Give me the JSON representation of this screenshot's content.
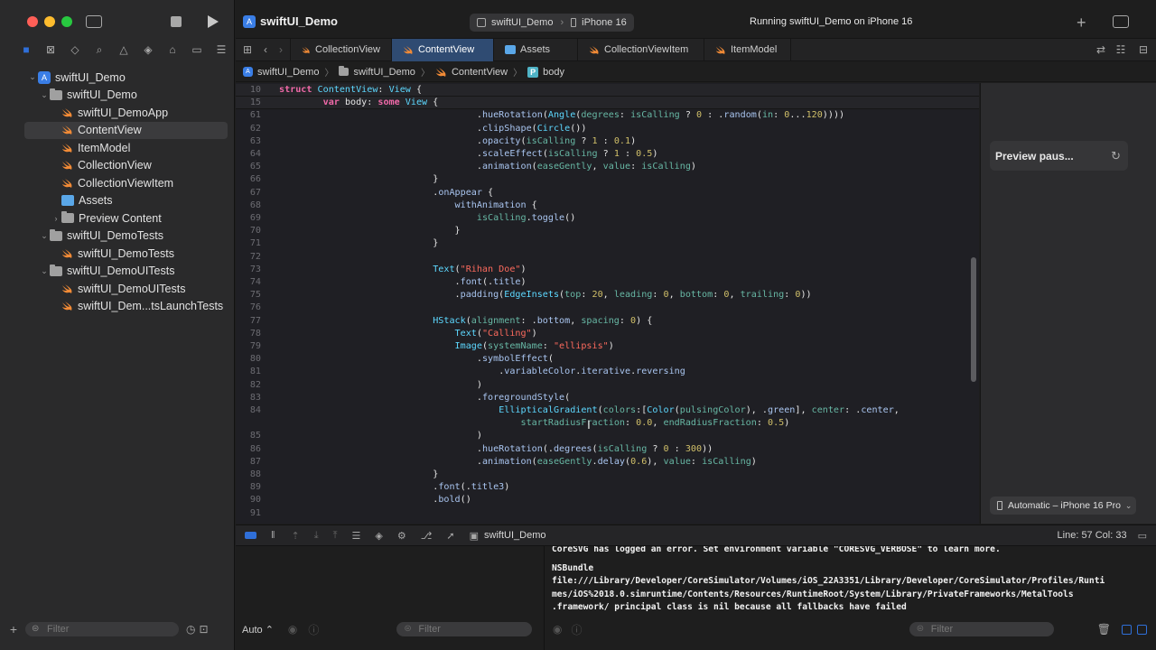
{
  "window": {
    "project_title": "swiftUI_Demo",
    "scheme": "swiftUI_Demo",
    "destination": "iPhone 16",
    "status": "Running swiftUI_Demo on iPhone 16"
  },
  "tabs": [
    {
      "label": "CollectionView",
      "icon": "swift-file-icon"
    },
    {
      "label": "ContentView",
      "icon": "swift-file-icon",
      "active": true
    },
    {
      "label": "Assets",
      "icon": "assets-icon"
    },
    {
      "label": "CollectionViewItem",
      "icon": "swift-file-icon"
    },
    {
      "label": "ItemModel",
      "icon": "swift-file-icon"
    }
  ],
  "breadcrumb": [
    "swiftUI_Demo",
    "swiftUI_Demo",
    "ContentView",
    "body"
  ],
  "navigator": {
    "items": [
      {
        "label": "swiftUI_Demo",
        "kind": "project",
        "depth": 0,
        "expanded": true
      },
      {
        "label": "swiftUI_Demo",
        "kind": "folder",
        "depth": 1,
        "expanded": true
      },
      {
        "label": "swiftUI_DemoApp",
        "kind": "swift",
        "depth": 2
      },
      {
        "label": "ContentView",
        "kind": "swift",
        "depth": 2,
        "selected": true
      },
      {
        "label": "ItemModel",
        "kind": "swift",
        "depth": 2
      },
      {
        "label": "CollectionView",
        "kind": "swift",
        "depth": 2
      },
      {
        "label": "CollectionViewItem",
        "kind": "swift",
        "depth": 2
      },
      {
        "label": "Assets",
        "kind": "assets",
        "depth": 2
      },
      {
        "label": "Preview Content",
        "kind": "folder",
        "depth": 2,
        "expanded": false
      },
      {
        "label": "swiftUI_DemoTests",
        "kind": "folder",
        "depth": 1,
        "expanded": true
      },
      {
        "label": "swiftUI_DemoTests",
        "kind": "swift",
        "depth": 2
      },
      {
        "label": "swiftUI_DemoUITests",
        "kind": "folder",
        "depth": 1,
        "expanded": true
      },
      {
        "label": "swiftUI_DemoUITests",
        "kind": "swift",
        "depth": 2
      },
      {
        "label": "swiftUI_Dem...tsLaunchTests",
        "kind": "swift",
        "depth": 2
      }
    ],
    "filter_placeholder": "Filter"
  },
  "code": [
    {
      "n": "10",
      "sticky": true,
      "ind": 0,
      "tok": [
        [
          "k",
          "struct "
        ],
        [
          "t",
          "ContentView"
        ],
        [
          "d",
          ": "
        ],
        [
          "t",
          "View"
        ],
        [
          "d",
          " {"
        ]
      ]
    },
    {
      "n": "15",
      "sticky": true,
      "ind": 8,
      "tok": [
        [
          "k",
          "var "
        ],
        [
          "d",
          "body"
        ],
        [
          "d",
          ": "
        ],
        [
          "k",
          "some "
        ],
        [
          "t",
          "View"
        ],
        [
          "d",
          " {"
        ]
      ]
    },
    {
      "n": "61",
      "ind": 36,
      "tok": [
        [
          "d",
          "."
        ],
        [
          "f",
          "hueRotation"
        ],
        [
          "d",
          "("
        ],
        [
          "t",
          "Angle"
        ],
        [
          "d",
          "("
        ],
        [
          "p",
          "degrees"
        ],
        [
          "d",
          ": "
        ],
        [
          "p",
          "isCalling"
        ],
        [
          "d",
          " ? "
        ],
        [
          "n",
          "0"
        ],
        [
          "d",
          " : ."
        ],
        [
          "f",
          "random"
        ],
        [
          "d",
          "("
        ],
        [
          "p",
          "in"
        ],
        [
          "d",
          ": "
        ],
        [
          "n",
          "0"
        ],
        [
          "d",
          "..."
        ],
        [
          "n",
          "120"
        ],
        [
          "d",
          "))))"
        ]
      ]
    },
    {
      "n": "62",
      "ind": 36,
      "tok": [
        [
          "d",
          "."
        ],
        [
          "f",
          "clipShape"
        ],
        [
          "d",
          "("
        ],
        [
          "t",
          "Circle"
        ],
        [
          "d",
          "())"
        ]
      ]
    },
    {
      "n": "63",
      "ind": 36,
      "tok": [
        [
          "d",
          "."
        ],
        [
          "f",
          "opacity"
        ],
        [
          "d",
          "("
        ],
        [
          "p",
          "isCalling"
        ],
        [
          "d",
          " ? "
        ],
        [
          "n",
          "1"
        ],
        [
          "d",
          " : "
        ],
        [
          "n",
          "0.1"
        ],
        [
          "d",
          ")"
        ]
      ]
    },
    {
      "n": "64",
      "ind": 36,
      "tok": [
        [
          "d",
          "."
        ],
        [
          "f",
          "scaleEffect"
        ],
        [
          "d",
          "("
        ],
        [
          "p",
          "isCalling"
        ],
        [
          "d",
          " ? "
        ],
        [
          "n",
          "1"
        ],
        [
          "d",
          " : "
        ],
        [
          "n",
          "0.5"
        ],
        [
          "d",
          ")"
        ]
      ]
    },
    {
      "n": "65",
      "ind": 36,
      "tok": [
        [
          "d",
          "."
        ],
        [
          "f",
          "animation"
        ],
        [
          "d",
          "("
        ],
        [
          "p",
          "easeGently"
        ],
        [
          "d",
          ", "
        ],
        [
          "p",
          "value"
        ],
        [
          "d",
          ": "
        ],
        [
          "p",
          "isCalling"
        ],
        [
          "d",
          ")"
        ]
      ]
    },
    {
      "n": "66",
      "ind": 28,
      "tok": [
        [
          "d",
          "}"
        ]
      ]
    },
    {
      "n": "67",
      "ind": 28,
      "tok": [
        [
          "d",
          "."
        ],
        [
          "f",
          "onAppear"
        ],
        [
          "d",
          " {"
        ]
      ]
    },
    {
      "n": "68",
      "ind": 32,
      "tok": [
        [
          "f",
          "withAnimation"
        ],
        [
          "d",
          " {"
        ]
      ]
    },
    {
      "n": "69",
      "ind": 36,
      "tok": [
        [
          "p",
          "isCalling"
        ],
        [
          "d",
          "."
        ],
        [
          "f",
          "toggle"
        ],
        [
          "d",
          "()"
        ]
      ]
    },
    {
      "n": "70",
      "ind": 32,
      "tok": [
        [
          "d",
          "}"
        ]
      ]
    },
    {
      "n": "71",
      "ind": 28,
      "tok": [
        [
          "d",
          "}"
        ]
      ]
    },
    {
      "n": "72",
      "ind": 0,
      "tok": []
    },
    {
      "n": "73",
      "ind": 28,
      "tok": [
        [
          "t",
          "Text"
        ],
        [
          "d",
          "("
        ],
        [
          "s",
          "\"Rihan Doe\""
        ],
        [
          "d",
          ")"
        ]
      ]
    },
    {
      "n": "74",
      "ind": 32,
      "tok": [
        [
          "d",
          "."
        ],
        [
          "f",
          "font"
        ],
        [
          "d",
          "(."
        ],
        [
          "f",
          "title"
        ],
        [
          "d",
          ")"
        ]
      ]
    },
    {
      "n": "75",
      "ind": 32,
      "tok": [
        [
          "d",
          "."
        ],
        [
          "f",
          "padding"
        ],
        [
          "d",
          "("
        ],
        [
          "t",
          "EdgeInsets"
        ],
        [
          "d",
          "("
        ],
        [
          "p",
          "top"
        ],
        [
          "d",
          ": "
        ],
        [
          "n",
          "20"
        ],
        [
          "d",
          ", "
        ],
        [
          "p",
          "leading"
        ],
        [
          "d",
          ": "
        ],
        [
          "n",
          "0"
        ],
        [
          "d",
          ", "
        ],
        [
          "p",
          "bottom"
        ],
        [
          "d",
          ": "
        ],
        [
          "n",
          "0"
        ],
        [
          "d",
          ", "
        ],
        [
          "p",
          "trailing"
        ],
        [
          "d",
          ": "
        ],
        [
          "n",
          "0"
        ],
        [
          "d",
          "))"
        ]
      ]
    },
    {
      "n": "76",
      "ind": 0,
      "tok": []
    },
    {
      "n": "77",
      "ind": 28,
      "tok": [
        [
          "t",
          "HStack"
        ],
        [
          "d",
          "("
        ],
        [
          "p",
          "alignment"
        ],
        [
          "d",
          ": ."
        ],
        [
          "f",
          "bottom"
        ],
        [
          "d",
          ", "
        ],
        [
          "p",
          "spacing"
        ],
        [
          "d",
          ": "
        ],
        [
          "n",
          "0"
        ],
        [
          "d",
          ") {"
        ]
      ]
    },
    {
      "n": "78",
      "ind": 32,
      "tok": [
        [
          "t",
          "Text"
        ],
        [
          "d",
          "("
        ],
        [
          "s",
          "\"Calling\""
        ],
        [
          "d",
          ")"
        ]
      ]
    },
    {
      "n": "79",
      "ind": 32,
      "tok": [
        [
          "t",
          "Image"
        ],
        [
          "d",
          "("
        ],
        [
          "p",
          "systemName"
        ],
        [
          "d",
          ": "
        ],
        [
          "s",
          "\"ellipsis\""
        ],
        [
          "d",
          ")"
        ]
      ]
    },
    {
      "n": "80",
      "ind": 36,
      "tok": [
        [
          "d",
          "."
        ],
        [
          "f",
          "symbolEffect"
        ],
        [
          "d",
          "("
        ]
      ]
    },
    {
      "n": "81",
      "ind": 40,
      "tok": [
        [
          "d",
          "."
        ],
        [
          "f",
          "variableColor"
        ],
        [
          "d",
          "."
        ],
        [
          "f",
          "iterative"
        ],
        [
          "d",
          "."
        ],
        [
          "f",
          "reversing"
        ]
      ]
    },
    {
      "n": "82",
      "ind": 36,
      "tok": [
        [
          "d",
          ")"
        ]
      ]
    },
    {
      "n": "83",
      "ind": 36,
      "tok": [
        [
          "d",
          "."
        ],
        [
          "f",
          "foregroundStyle"
        ],
        [
          "d",
          "("
        ]
      ]
    },
    {
      "n": "84",
      "ind": 40,
      "tok": [
        [
          "t",
          "EllipticalGradient"
        ],
        [
          "d",
          "("
        ],
        [
          "p",
          "colors"
        ],
        [
          "d",
          ":["
        ],
        [
          "t",
          "Color"
        ],
        [
          "d",
          "("
        ],
        [
          "p",
          "pulsingColor"
        ],
        [
          "d",
          "), ."
        ],
        [
          "f",
          "green"
        ],
        [
          "d",
          "], "
        ],
        [
          "p",
          "center"
        ],
        [
          "d",
          ": ."
        ],
        [
          "f",
          "center"
        ],
        [
          "d",
          ","
        ]
      ]
    },
    {
      "n": "",
      "ind": 44,
      "tok": [
        [
          "p",
          "startRadiusFraction"
        ],
        [
          "d",
          ": "
        ],
        [
          "n",
          "0.0"
        ],
        [
          "d",
          ", "
        ],
        [
          "p",
          "endRadiusFraction"
        ],
        [
          "d",
          ": "
        ],
        [
          "n",
          "0.5"
        ],
        [
          "d",
          ")"
        ]
      ]
    },
    {
      "n": "85",
      "ind": 36,
      "tok": [
        [
          "d",
          ")"
        ]
      ]
    },
    {
      "n": "86",
      "ind": 36,
      "tok": [
        [
          "d",
          "."
        ],
        [
          "f",
          "hueRotation"
        ],
        [
          "d",
          "(."
        ],
        [
          "f",
          "degrees"
        ],
        [
          "d",
          "("
        ],
        [
          "p",
          "isCalling"
        ],
        [
          "d",
          " ? "
        ],
        [
          "n",
          "0"
        ],
        [
          "d",
          " : "
        ],
        [
          "n",
          "300"
        ],
        [
          "d",
          "))"
        ]
      ]
    },
    {
      "n": "87",
      "ind": 36,
      "tok": [
        [
          "d",
          "."
        ],
        [
          "f",
          "animation"
        ],
        [
          "d",
          "("
        ],
        [
          "p",
          "easeGently"
        ],
        [
          "d",
          "."
        ],
        [
          "f",
          "delay"
        ],
        [
          "d",
          "("
        ],
        [
          "n",
          "0.6"
        ],
        [
          "d",
          "), "
        ],
        [
          "p",
          "value"
        ],
        [
          "d",
          ": "
        ],
        [
          "p",
          "isCalling"
        ],
        [
          "d",
          ")"
        ]
      ]
    },
    {
      "n": "88",
      "ind": 28,
      "tok": [
        [
          "d",
          "}"
        ]
      ]
    },
    {
      "n": "89",
      "ind": 28,
      "tok": [
        [
          "d",
          "."
        ],
        [
          "f",
          "font"
        ],
        [
          "d",
          "(."
        ],
        [
          "f",
          "title3"
        ],
        [
          "d",
          ")"
        ]
      ]
    },
    {
      "n": "90",
      "ind": 28,
      "tok": [
        [
          "d",
          "."
        ],
        [
          "f",
          "bold"
        ],
        [
          "d",
          "()"
        ]
      ]
    },
    {
      "n": "91",
      "ind": 0,
      "tok": []
    }
  ],
  "preview": {
    "status": "Preview paus...",
    "device": "Automatic – iPhone 16 Pro"
  },
  "debug": {
    "target": "swiftUI_Demo",
    "cursor": "Line: 57  Col: 33",
    "auto_label": "Auto",
    "var_filter_placeholder": "Filter",
    "console_filter_placeholder": "Filter",
    "console_lines": [
      "CoreSVG has logged an error. Set environment variable \"CORESVG_VERBOSE\" to learn more.",
      "",
      "NSBundle",
      "file:///Library/Developer/CoreSimulator/Volumes/iOS_22A3351/Library/Developer/CoreSimulator/Profiles/Runti",
      "mes/iOS%2018.0.simruntime/Contents/Resources/RuntimeRoot/System/Library/PrivateFrameworks/MetalTools",
      ".framework/ principal class is nil because all fallbacks have failed"
    ]
  },
  "colors": {
    "accent": "#2f6fd8",
    "swift": "#f08a36",
    "keyword": "#f069a8",
    "type": "#5dd8ff",
    "string": "#fc6a5d",
    "number": "#d0bf69"
  }
}
